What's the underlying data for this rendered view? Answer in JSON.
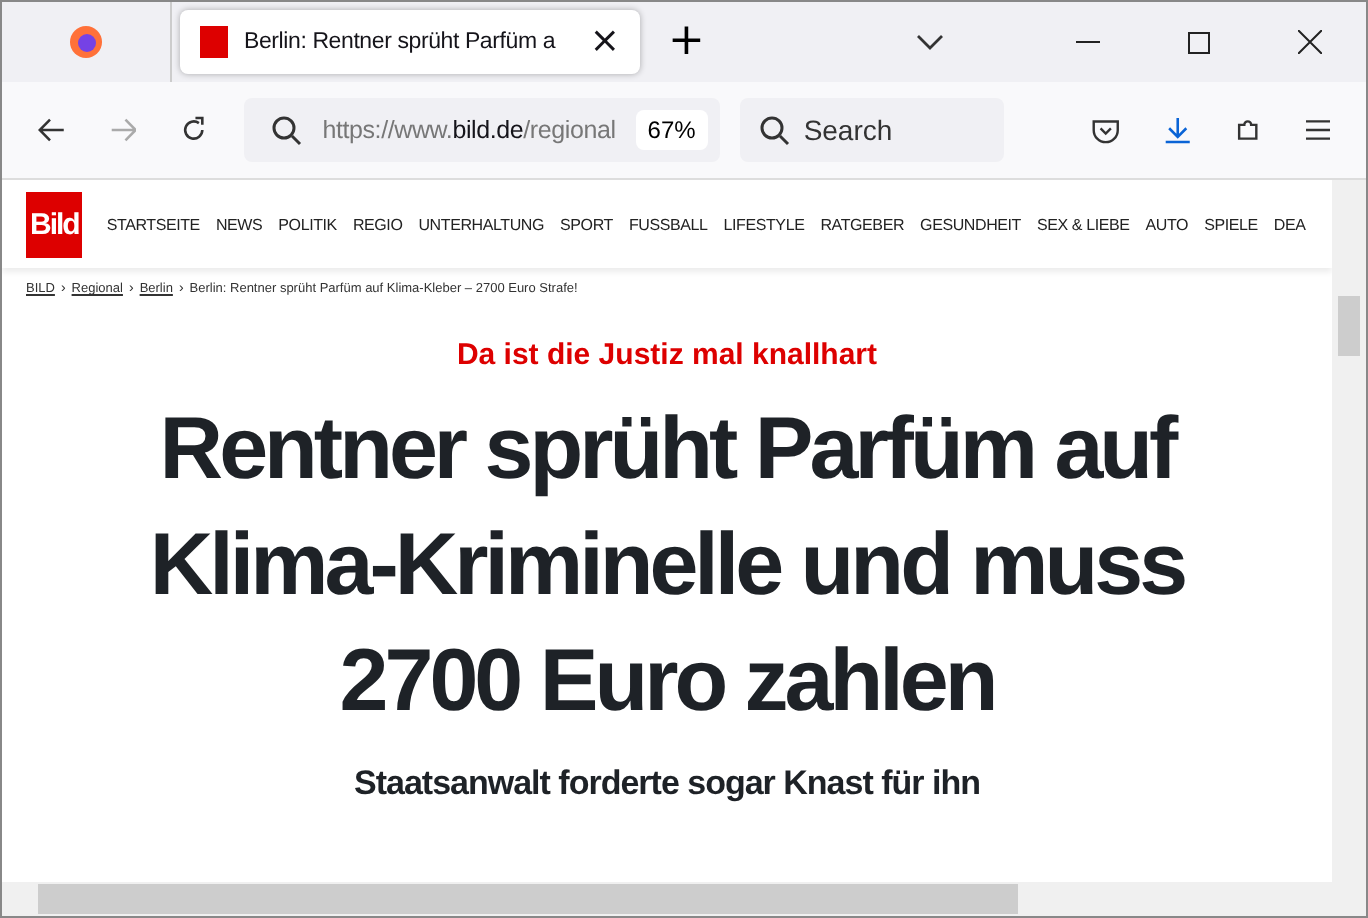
{
  "tabs": [
    {
      "title": "Berlin: Rentner sprüht Parfüm a",
      "selected": true,
      "close": "×"
    }
  ],
  "new_tab": "+",
  "toolbar": {
    "url_plain": "https://www.",
    "url_domain": "bild.de",
    "url_path": "/regional",
    "zoom": "67%",
    "search": {
      "placeholder": "Search"
    }
  },
  "site": {
    "logo": "Bild",
    "nav": [
      "STARTSEITE",
      "NEWS",
      "POLITIK",
      "REGIO",
      "UNTERHALTUNG",
      "SPORT",
      "FUSSBALL",
      "LIFESTYLE",
      "RATGEBER",
      "GESUNDHEIT",
      "SEX & LIEBE",
      "AUTO",
      "SPIELE",
      "DEA"
    ]
  },
  "breadcrumb_separator": "›",
  "breadcrumb": [
    {
      "text": "BILD",
      "kind": "link"
    },
    {
      "text": "Regional",
      "kind": "link"
    },
    {
      "text": "Berlin",
      "kind": "link"
    },
    {
      "text": "Berlin: Rentner sprüht Parfüm auf Klima-Kleber – 2700 Euro Strafe!",
      "kind": "current"
    }
  ],
  "article": {
    "kicker": "Da ist die Justiz mal knallhart",
    "headline": "Rentner sprüht Parfüm auf Klima-Kriminelle und muss 2700 Euro zahlen",
    "subheadline": "Staatsanwalt forderte sogar Knast für ihn"
  }
}
